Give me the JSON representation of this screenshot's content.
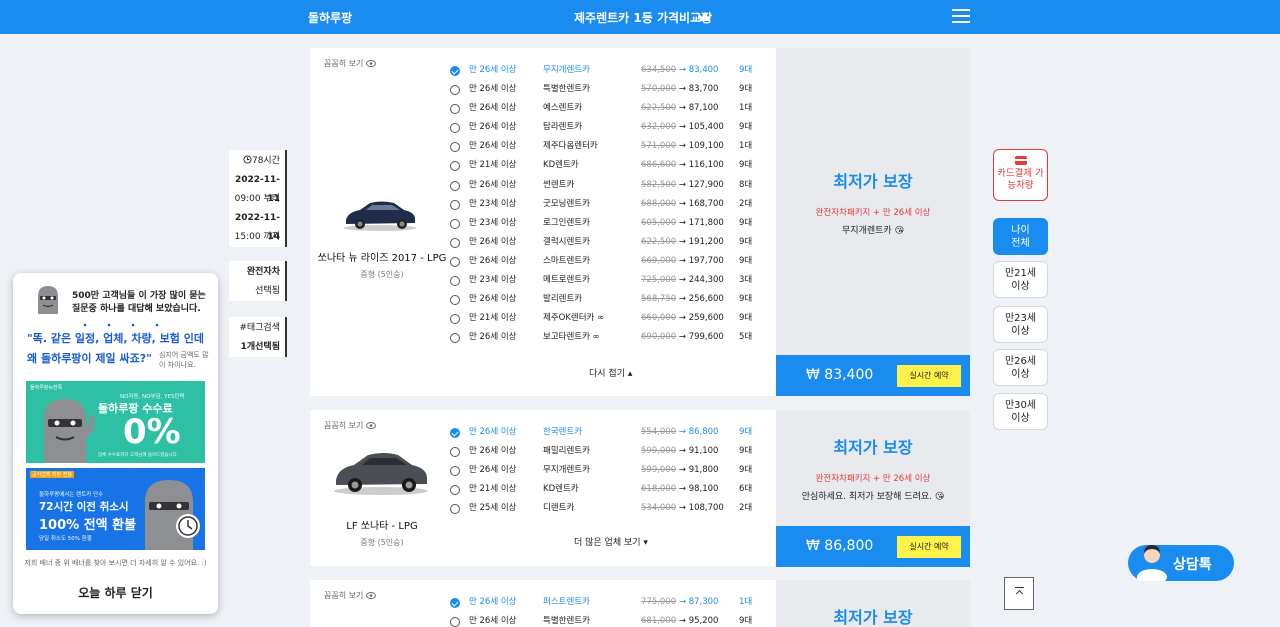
{
  "header": {
    "brand": "돌하루팡",
    "tagline": "제주렌트카 1등 가격비교팡"
  },
  "filter_left": {
    "duration": "78시간",
    "start_date": "2022-11-11",
    "start_time": "09:00 부터",
    "end_date": "2022-11-14",
    "end_time": "15:00 까지",
    "coverage": "완전자차",
    "coverage_sub": "선택됨",
    "hashtag": "#태그검색",
    "hashtag_sub": "1개선택됨"
  },
  "cards": [
    {
      "view_label": "꼼꼼히 보기",
      "car_name": "쏘나타 뉴 라이즈 2017 - LPG",
      "car_class": "중형 (5인승)",
      "rows": [
        {
          "age": "만 26세 이상",
          "company": "무지개렌트카",
          "old": "634,500",
          "new": "83,400",
          "count": "9대",
          "selected": true
        },
        {
          "age": "만 26세 이상",
          "company": "특별한렌트카",
          "old": "570,000",
          "new": "83,700",
          "count": "9대"
        },
        {
          "age": "만 26세 이상",
          "company": "예스렌트카",
          "old": "622,500",
          "new": "87,100",
          "count": "1대"
        },
        {
          "age": "만 26세 이상",
          "company": "탐라렌트카",
          "old": "632,000",
          "new": "105,400",
          "count": "9대"
        },
        {
          "age": "만 26세 이상",
          "company": "제주다옴렌터카",
          "old": "571,000",
          "new": "109,100",
          "count": "1대"
        },
        {
          "age": "만 21세 이상",
          "company": "KD렌트카",
          "old": "686,600",
          "new": "116,100",
          "count": "9대"
        },
        {
          "age": "만 26세 이상",
          "company": "썬렌트카",
          "old": "582,500",
          "new": "127,900",
          "count": "8대"
        },
        {
          "age": "만 23세 이상",
          "company": "굿모닝렌트카",
          "old": "688,000",
          "new": "168,700",
          "count": "2대"
        },
        {
          "age": "만 23세 이상",
          "company": "로그인렌트카",
          "old": "605,000",
          "new": "171,800",
          "count": "9대"
        },
        {
          "age": "만 26세 이상",
          "company": "갤럭시렌트카",
          "old": "622,500",
          "new": "191,200",
          "count": "9대"
        },
        {
          "age": "만 26세 이상",
          "company": "스마트렌트카",
          "old": "669,000",
          "new": "197,700",
          "count": "9대"
        },
        {
          "age": "만 23세 이상",
          "company": "메트로렌트카",
          "old": "725,000",
          "new": "244,300",
          "count": "3대"
        },
        {
          "age": "만 26세 이상",
          "company": "발리렌트카",
          "old": "568,750",
          "new": "256,600",
          "count": "9대"
        },
        {
          "age": "만 21세 이상",
          "company": "제주OK렌터카 ∞",
          "old": "660,000",
          "new": "259,600",
          "count": "9대"
        },
        {
          "age": "만 26세 이상",
          "company": "보고타렌트카 ∞",
          "old": "690,000",
          "new": "799,600",
          "count": "5대"
        }
      ],
      "more_label": "다시 접기",
      "best_label": "최저가 보장",
      "package_label": "완전자차패키지 + 만 26세 이상",
      "pick_label": "무지개렌트카 😘",
      "price": "₩ 83,400",
      "reserve_label": "실시간 예약"
    },
    {
      "view_label": "꼼꼼히 보기",
      "car_name": "LF 쏘나타 - LPG",
      "car_class": "중형 (5인승)",
      "rows": [
        {
          "age": "만 26세 이상",
          "company": "한국렌트카",
          "old": "554,000",
          "new": "86,800",
          "count": "9대",
          "selected": true
        },
        {
          "age": "만 26세 이상",
          "company": "패밀리렌트카",
          "old": "599,000",
          "new": "91,100",
          "count": "9대"
        },
        {
          "age": "만 26세 이상",
          "company": "무지개렌트카",
          "old": "599,000",
          "new": "91,800",
          "count": "9대"
        },
        {
          "age": "만 21세 이상",
          "company": "KD렌트카",
          "old": "618,000",
          "new": "98,100",
          "count": "6대"
        },
        {
          "age": "만 25세 이상",
          "company": "디렌트카",
          "old": "534,000",
          "new": "108,700",
          "count": "2대"
        }
      ],
      "more_label": "더 많은 업체 보기",
      "best_label": "최저가 보장",
      "package_label": "완전자차패키지 + 만 26세 이상",
      "pick_label": "안심하세요. 최저가 보장해 드려요. 😘",
      "price": "₩ 86,800",
      "reserve_label": "실시간 예약"
    },
    {
      "view_label": "꼼꼼히 보기",
      "rows": [
        {
          "age": "만 26세 이상",
          "company": "퍼스트렌트카",
          "old": "775,000",
          "new": "87,300",
          "count": "1대",
          "selected": true
        },
        {
          "age": "만 26세 이상",
          "company": "특별한렌트카",
          "old": "681,000",
          "new": "95,200",
          "count": "9대"
        }
      ],
      "best_label": "최저가 보장"
    }
  ],
  "filter_right": {
    "card_pay": "카드결제 가능차량",
    "ages": [
      "나이 전체",
      "만21세 이상",
      "만23세 이상",
      "만26세 이상",
      "만30세 이상"
    ]
  },
  "chat_label": "상담톡",
  "popup": {
    "headline": "500만 고객님들 이 가장 많이 묻는 질문중 하나를 대답해 보았습니다.",
    "quote": "\"똑. 같은 일정, 업체, 차량, 보험 인데 왜 돌하루팡이 제일 싸죠?\"",
    "side_note": "심지어 금액도 많이 차이나요.",
    "banner1": {
      "tag": "돌하루팡뉴한쪽",
      "sub": "NO자동, NO부담, YES탄력",
      "main": "돌하루팡 수수료",
      "big": "0%",
      "foot": "업체 수수료까지 고객님께 돌려드렸습니다."
    },
    "banner2": {
      "tag": "공식업체 직판 전월",
      "sub": "돌하루팡에서는 렌트카 단수",
      "main": "72시간 이전 취소시",
      "big": "100% 전액 환불",
      "foot": "당일 취소도 50% 환불"
    },
    "foot_note": "저희 배너 중 위 배너를 찾아 보시면 더 자세히 알 수 있어요. :)",
    "close_label": "오늘 하루 닫기"
  },
  "colors": {
    "brand_blue": "#1a8cf0",
    "accent_red": "#e03c3c",
    "reserve_yellow": "#fff24a",
    "background": "#eef1f5"
  }
}
